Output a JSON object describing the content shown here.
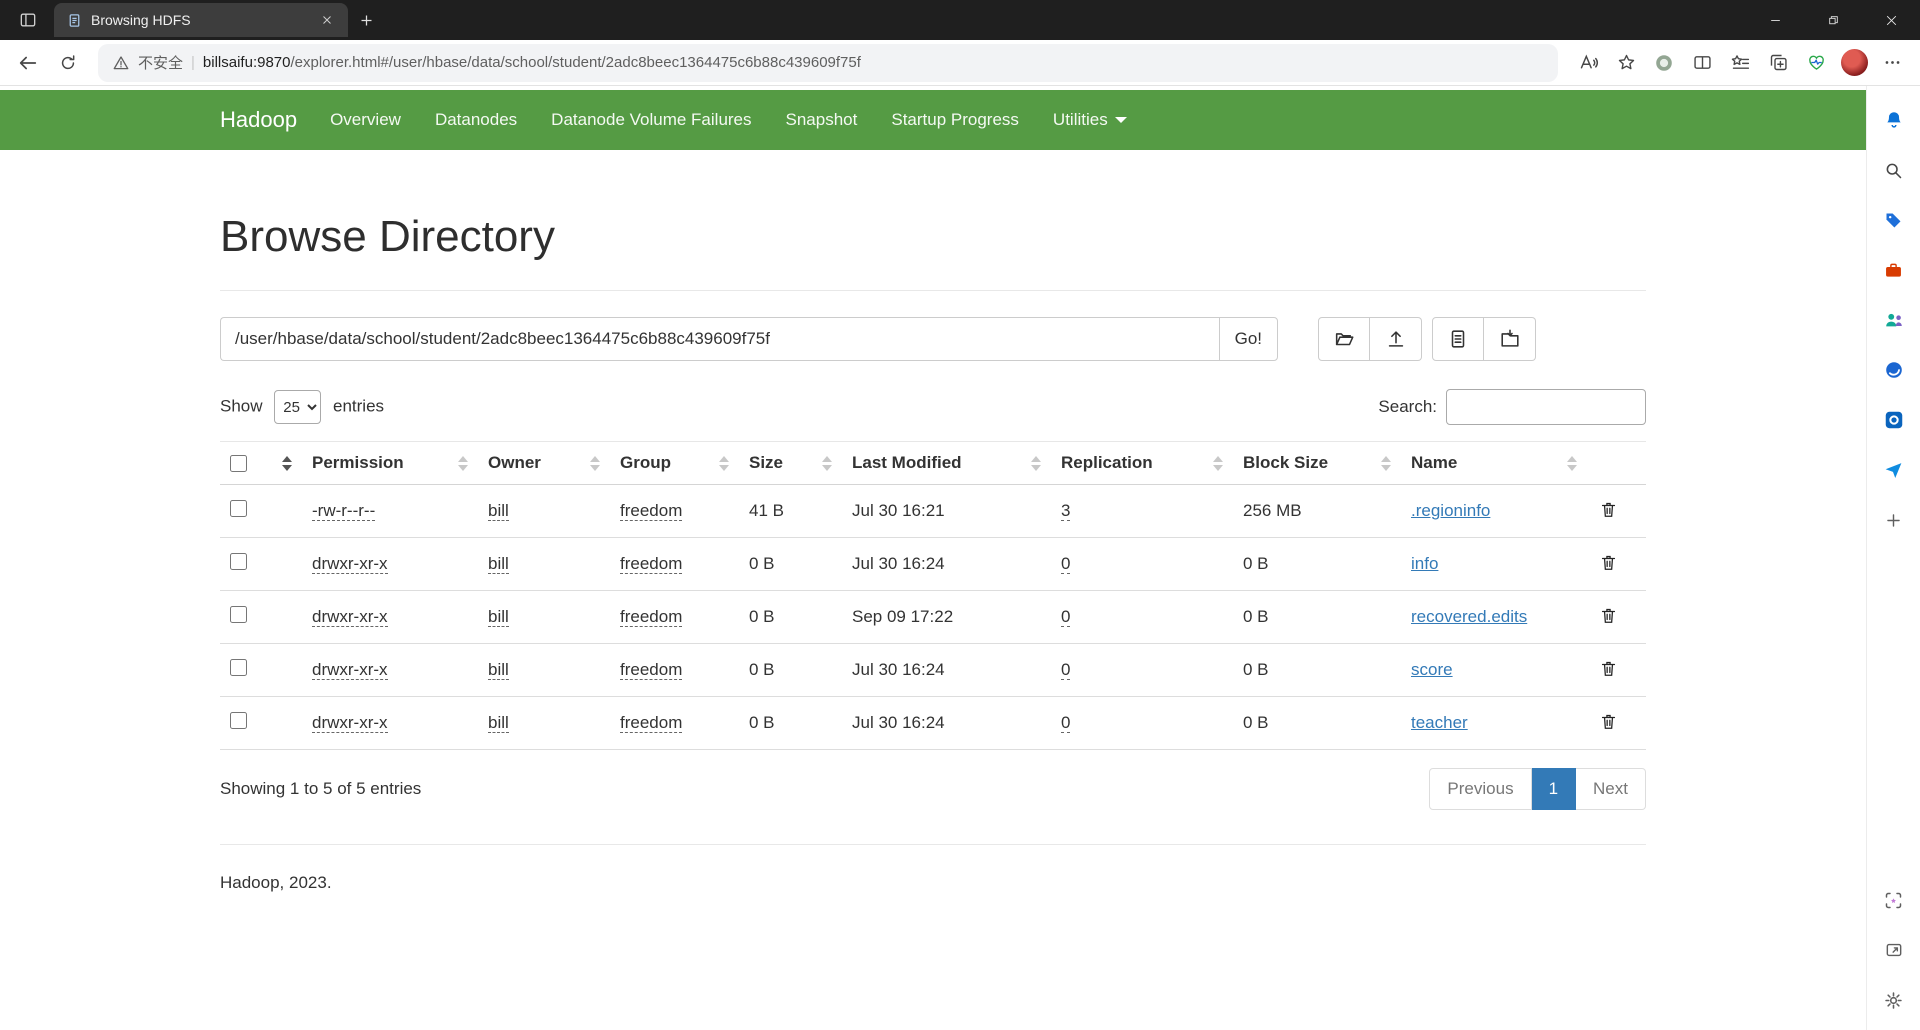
{
  "browser": {
    "tab_title": "Browsing HDFS",
    "security_label": "不安全",
    "url_host": "billsaifu:9870",
    "url_path": "/explorer.html#/user/hbase/data/school/student/2adc8beec1364475c6b88c439609f75f"
  },
  "navbar": {
    "brand": "Hadoop",
    "items": [
      "Overview",
      "Datanodes",
      "Datanode Volume Failures",
      "Snapshot",
      "Startup Progress",
      "Utilities"
    ]
  },
  "page": {
    "title": "Browse Directory",
    "path_value": "/user/hbase/data/school/student/2adc8beec1364475c6b88c439609f75f",
    "go_label": "Go!",
    "show_label": "Show",
    "page_size": "25",
    "entries_label": "entries",
    "search_label": "Search:",
    "showing_text": "Showing 1 to 5 of 5 entries",
    "footer": "Hadoop, 2023."
  },
  "pagination": {
    "previous": "Previous",
    "page": "1",
    "next": "Next"
  },
  "table": {
    "headers": {
      "permission": "Permission",
      "owner": "Owner",
      "group": "Group",
      "size": "Size",
      "last_modified": "Last Modified",
      "replication": "Replication",
      "block_size": "Block Size",
      "name": "Name"
    },
    "rows": [
      {
        "permission": "-rw-r--r--",
        "owner": "bill",
        "group": "freedom",
        "size": "41 B",
        "modified": "Jul 30 16:21",
        "replication": "3",
        "block_size": "256 MB",
        "name": ".regioninfo"
      },
      {
        "permission": "drwxr-xr-x",
        "owner": "bill",
        "group": "freedom",
        "size": "0 B",
        "modified": "Jul 30 16:24",
        "replication": "0",
        "block_size": "0 B",
        "name": "info"
      },
      {
        "permission": "drwxr-xr-x",
        "owner": "bill",
        "group": "freedom",
        "size": "0 B",
        "modified": "Sep 09 17:22",
        "replication": "0",
        "block_size": "0 B",
        "name": "recovered.edits"
      },
      {
        "permission": "drwxr-xr-x",
        "owner": "bill",
        "group": "freedom",
        "size": "0 B",
        "modified": "Jul 30 16:24",
        "replication": "0",
        "block_size": "0 B",
        "name": "score"
      },
      {
        "permission": "drwxr-xr-x",
        "owner": "bill",
        "group": "freedom",
        "size": "0 B",
        "modified": "Jul 30 16:24",
        "replication": "0",
        "block_size": "0 B",
        "name": "teacher"
      }
    ]
  }
}
